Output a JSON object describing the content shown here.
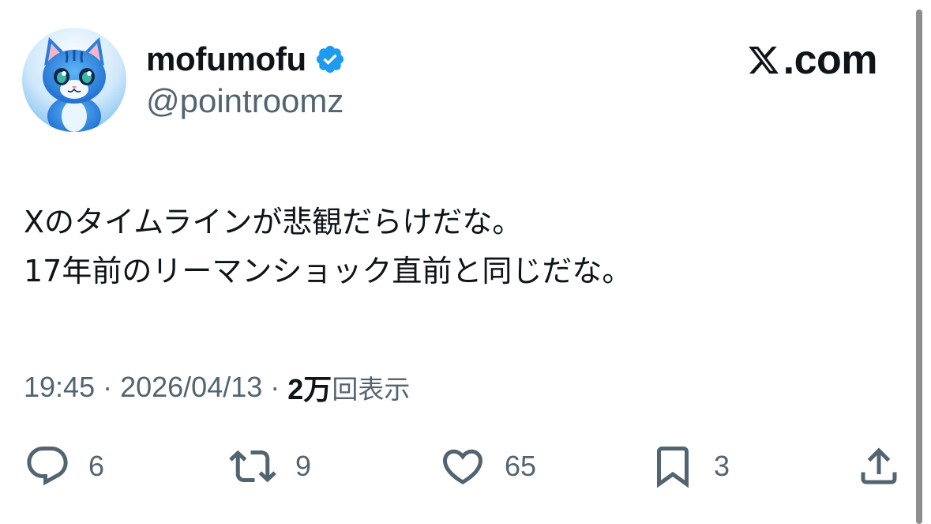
{
  "author": {
    "display_name": "mofumofu",
    "handle": "@pointroomz",
    "verified": true,
    "avatar": "blue-cat-avatar"
  },
  "site": {
    "logo_text": ".com",
    "logo_icon": "x-logo-icon"
  },
  "tweet": {
    "lines": [
      "Xのタイムラインが悲観だらけだな。",
      "17年前のリーマンショック直前と同じだな。"
    ]
  },
  "meta": {
    "time": "19:45",
    "date": "2026/04/13",
    "separator": "·",
    "views_count": "2万",
    "views_label": "回表示"
  },
  "actions": {
    "reply": {
      "icon": "reply-icon",
      "count": "6"
    },
    "repost": {
      "icon": "repost-icon",
      "count": "9"
    },
    "like": {
      "icon": "heart-icon",
      "count": "65"
    },
    "bookmark": {
      "icon": "bookmark-icon",
      "count": "3"
    },
    "share": {
      "icon": "share-icon"
    }
  },
  "colors": {
    "text_primary": "#0f1419",
    "text_secondary": "#536471",
    "verified_blue": "#1d9bf0",
    "icon_gray": "#536471"
  }
}
